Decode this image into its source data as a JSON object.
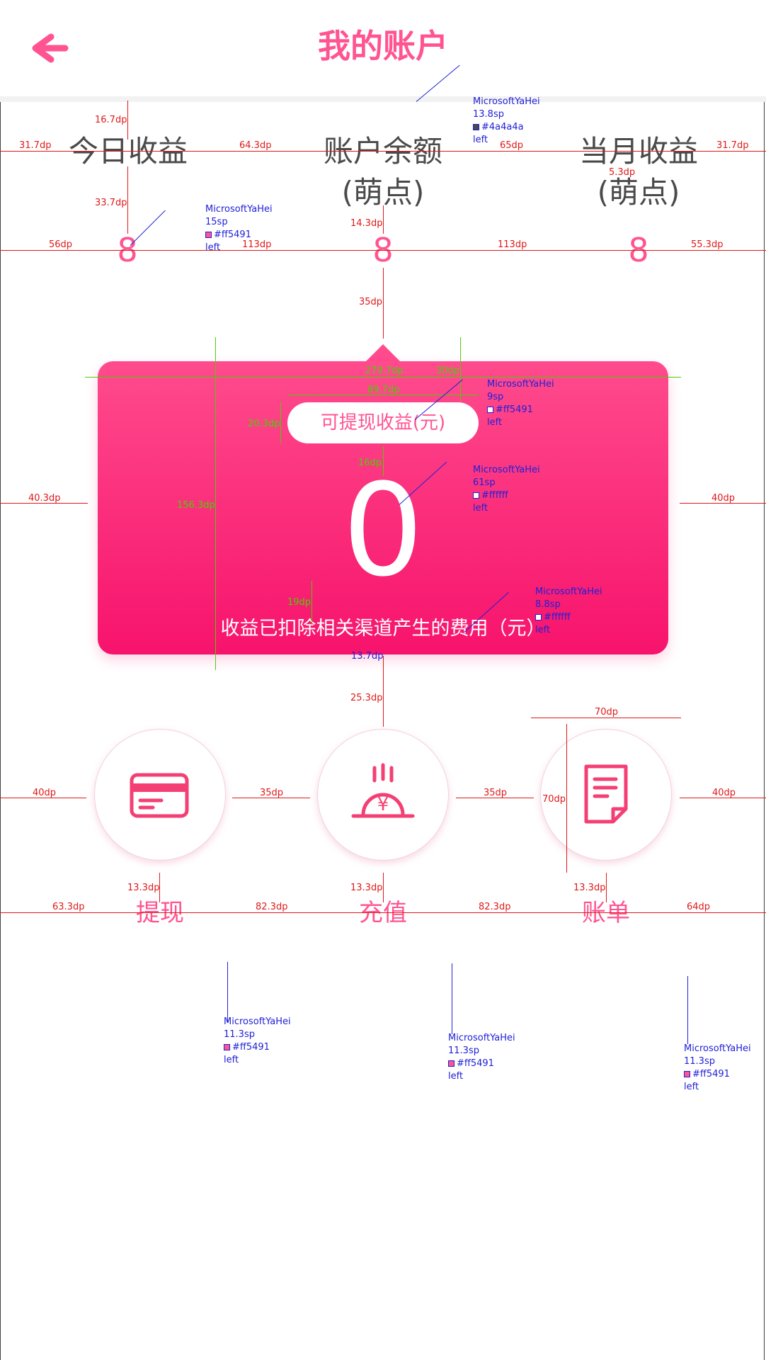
{
  "header": {
    "title": "我的账户",
    "back_icon": "back-arrow-icon",
    "brand_color": "#ff5491"
  },
  "stats": [
    {
      "label_line1": "今日收益",
      "label_line2": "",
      "value": "8"
    },
    {
      "label_line1": "账户余额",
      "label_line2": "(萌点)",
      "value": "8"
    },
    {
      "label_line1": "当月收益",
      "label_line2": "(萌点)",
      "value": "8"
    }
  ],
  "card": {
    "pill_label": "可提现收益(元)",
    "amount": "0",
    "note": "收益已扣除相关渠道产生的费用（元）",
    "gradient_top": "#ff4b8d",
    "gradient_bottom": "#f7136c"
  },
  "actions": [
    {
      "label": "提现",
      "icon": "card-icon"
    },
    {
      "label": "充值",
      "icon": "yen-coin-icon"
    },
    {
      "label": "账单",
      "icon": "document-icon"
    }
  ],
  "annotations": {
    "spacing": [
      "16.7dp",
      "31.7dp",
      "64.3dp",
      "65dp",
      "31.7dp",
      "33.7dp",
      "5.3dp",
      "14.3dp",
      "56dp",
      "113dp",
      "113dp",
      "55.3dp",
      "35dp",
      "40.3dp",
      "40dp",
      "13.7dp",
      "25.3dp",
      "70dp",
      "40dp",
      "35dp",
      "35dp",
      "40dp",
      "70dp",
      "13.3dp",
      "13.3dp",
      "13.3dp",
      "63.3dp",
      "82.3dp",
      "82.3dp",
      "64dp"
    ],
    "card_measures": [
      "279.7dp",
      "30dp",
      "89.7dp",
      "20.3dp",
      "16dp",
      "156.3dp",
      "19dp"
    ],
    "font_specs": [
      {
        "font": "MicrosoftYaHei",
        "size": "13.8sp",
        "color": "#4a4a4a",
        "align": "left"
      },
      {
        "font": "MicrosoftYaHei",
        "size": "15sp",
        "color": "#ff5491",
        "align": "left"
      },
      {
        "font": "MicrosoftYaHei",
        "size": "9sp",
        "color": "#ff5491",
        "align": "left"
      },
      {
        "font": "MicrosoftYaHei",
        "size": "61sp",
        "color": "#ffffff",
        "align": "left"
      },
      {
        "font": "MicrosoftYaHei",
        "size": "8.8sp",
        "color": "#ffffff",
        "align": "left"
      },
      {
        "font": "MicrosoftYaHei",
        "size": "11.3sp",
        "color": "#ff5491",
        "align": "left"
      },
      {
        "font": "MicrosoftYaHei",
        "size": "11.3sp",
        "color": "#ff5491",
        "align": "left"
      },
      {
        "font": "MicrosoftYaHei",
        "size": "11.3sp",
        "color": "#ff5491",
        "align": "left"
      }
    ]
  }
}
